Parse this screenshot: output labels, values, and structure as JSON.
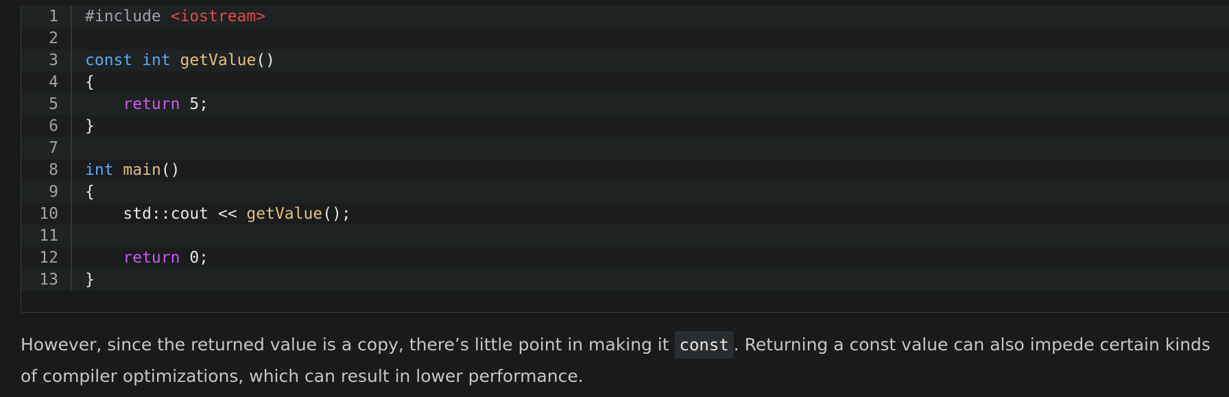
{
  "code": {
    "lines": [
      {
        "no": "1",
        "tokens": [
          {
            "t": "#include ",
            "c": "pre"
          },
          {
            "t": "<iostream>",
            "c": "str"
          }
        ]
      },
      {
        "no": "2",
        "tokens": []
      },
      {
        "no": "3",
        "tokens": [
          {
            "t": "const",
            "c": "kw"
          },
          {
            "t": " ",
            "c": "plain"
          },
          {
            "t": "int",
            "c": "kw"
          },
          {
            "t": " ",
            "c": "plain"
          },
          {
            "t": "getValue",
            "c": "fn"
          },
          {
            "t": "()",
            "c": "plain"
          }
        ]
      },
      {
        "no": "4",
        "tokens": [
          {
            "t": "{",
            "c": "plain"
          }
        ]
      },
      {
        "no": "5",
        "tokens": [
          {
            "t": "    ",
            "c": "plain"
          },
          {
            "t": "return",
            "c": "ret"
          },
          {
            "t": " 5;",
            "c": "plain"
          }
        ]
      },
      {
        "no": "6",
        "tokens": [
          {
            "t": "}",
            "c": "plain"
          }
        ]
      },
      {
        "no": "7",
        "tokens": []
      },
      {
        "no": "8",
        "tokens": [
          {
            "t": "int",
            "c": "kw"
          },
          {
            "t": " ",
            "c": "plain"
          },
          {
            "t": "main",
            "c": "fn"
          },
          {
            "t": "()",
            "c": "plain"
          }
        ]
      },
      {
        "no": "9",
        "tokens": [
          {
            "t": "{",
            "c": "plain"
          }
        ]
      },
      {
        "no": "10",
        "tokens": [
          {
            "t": "    std::cout << ",
            "c": "plain"
          },
          {
            "t": "getValue",
            "c": "fn"
          },
          {
            "t": "();",
            "c": "plain"
          }
        ]
      },
      {
        "no": "11",
        "tokens": []
      },
      {
        "no": "12",
        "tokens": [
          {
            "t": "    ",
            "c": "plain"
          },
          {
            "t": "return",
            "c": "ret"
          },
          {
            "t": " 0;",
            "c": "plain"
          }
        ]
      },
      {
        "no": "13",
        "tokens": [
          {
            "t": "}",
            "c": "plain"
          }
        ]
      }
    ]
  },
  "paragraph": {
    "before": "However, since the returned value is a copy, there’s little point in making it ",
    "code": "const",
    "after": ". Returning a const value can also impede certain kinds of compiler optimizations, which can result in lower performance."
  }
}
